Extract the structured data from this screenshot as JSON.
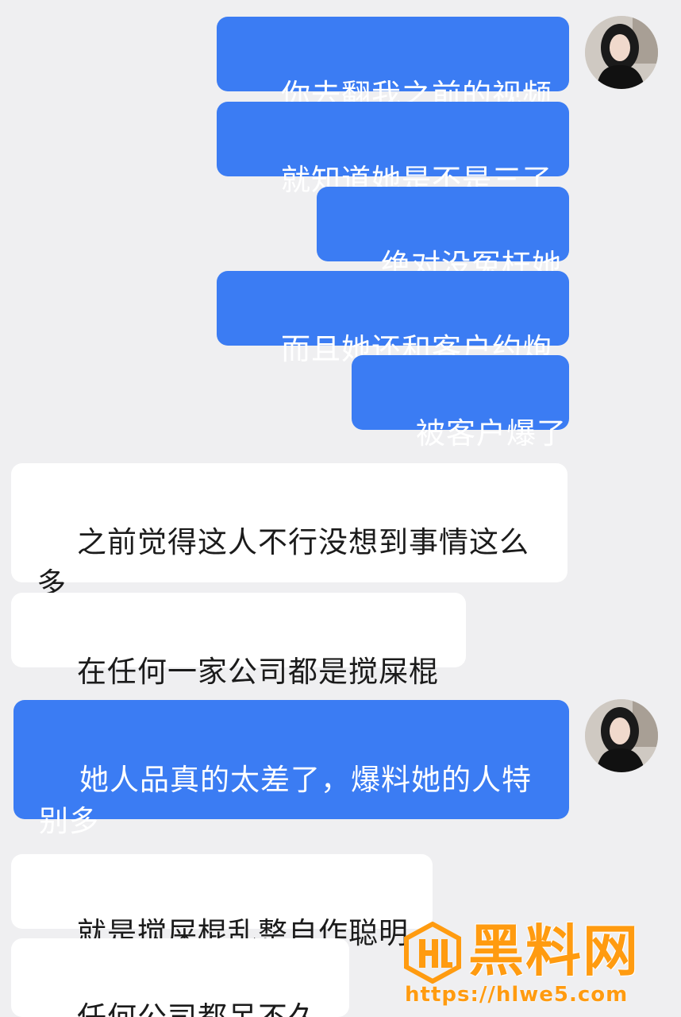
{
  "messages": [
    {
      "side": "out",
      "text": "你去翻我之前的视频"
    },
    {
      "side": "out",
      "text": "就知道她是不是三了"
    },
    {
      "side": "out",
      "text": "绝对没冤枉她"
    },
    {
      "side": "out",
      "text": "而且她还和客户约炮"
    },
    {
      "side": "out",
      "text": "被客户爆了"
    },
    {
      "side": "in",
      "text": "之前觉得这人不行没想到事情这么多"
    },
    {
      "side": "in",
      "text": "在任何一家公司都是搅屎棍"
    },
    {
      "side": "out",
      "text": "她人品真的太差了，爆料她的人特别多"
    },
    {
      "side": "in",
      "text": "就是搅屎棍乱整自作聪明"
    },
    {
      "side": "in",
      "text": "任何公司都呆不久、"
    }
  ],
  "avatars": [
    {
      "icon": "user-avatar-icon"
    },
    {
      "icon": "user-avatar-icon"
    }
  ],
  "watermark": {
    "brand": "黑料网",
    "url": "https://hlwe5.com",
    "logo_icon": "hl-logo-icon",
    "color": "#ff9b10"
  },
  "colors": {
    "outgoing_bubble": "#3b7cf3",
    "incoming_bubble": "#ffffff",
    "background": "#efeff1"
  }
}
